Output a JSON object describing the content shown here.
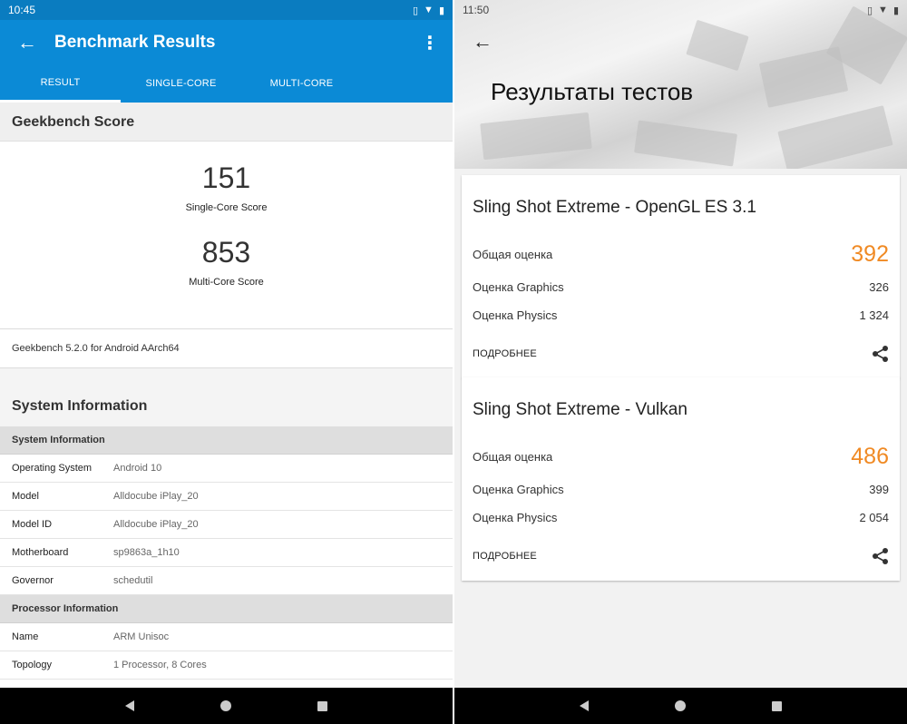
{
  "left": {
    "status_time": "10:45",
    "title": "Benchmark Results",
    "tabs": [
      "RESULT",
      "SINGLE-CORE",
      "MULTI-CORE"
    ],
    "score_header": "Geekbench Score",
    "single_value": "151",
    "single_label": "Single-Core Score",
    "multi_value": "853",
    "multi_label": "Multi-Core Score",
    "version": "Geekbench 5.2.0 for Android AArch64",
    "sys_header": "System Information",
    "groups": [
      {
        "title": "System Information",
        "rows": [
          {
            "k": "Operating System",
            "v": "Android 10"
          },
          {
            "k": "Model",
            "v": "Alldocube iPlay_20"
          },
          {
            "k": "Model ID",
            "v": "Alldocube iPlay_20"
          },
          {
            "k": "Motherboard",
            "v": "sp9863a_1h10"
          },
          {
            "k": "Governor",
            "v": "schedutil"
          }
        ]
      },
      {
        "title": "Processor Information",
        "rows": [
          {
            "k": "Name",
            "v": "ARM Unisoc"
          },
          {
            "k": "Topology",
            "v": "1 Processor, 8 Cores"
          }
        ]
      }
    ]
  },
  "right": {
    "status_time": "11:50",
    "title": "Результаты тестов",
    "cards": [
      {
        "title": "Sling Shot Extreme - OpenGL ES 3.1",
        "overall_label": "Общая оценка",
        "overall_value": "392",
        "graphics_label": "Оценка Graphics",
        "graphics_value": "326",
        "physics_label": "Оценка Physics",
        "physics_value": "1 324",
        "more_label": "ПОДРОБНЕЕ"
      },
      {
        "title": "Sling Shot Extreme - Vulkan",
        "overall_label": "Общая оценка",
        "overall_value": "486",
        "graphics_label": "Оценка Graphics",
        "graphics_value": "399",
        "physics_label": "Оценка Physics",
        "physics_value": "2 054",
        "more_label": "ПОДРОБНЕЕ"
      }
    ]
  },
  "colors": {
    "geekbench_blue": "#0b8ad6",
    "score_orange": "#f08a24"
  }
}
